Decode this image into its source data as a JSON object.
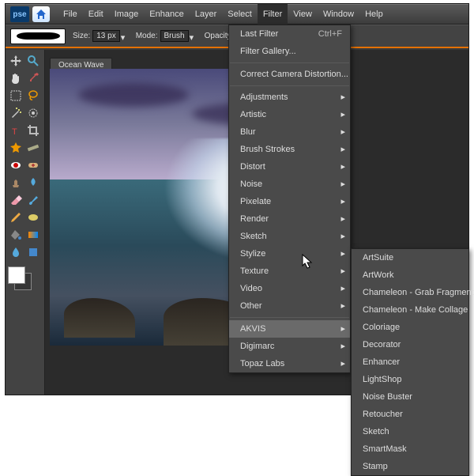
{
  "app": {
    "logo": "pse"
  },
  "menubar": [
    "File",
    "Edit",
    "Image",
    "Enhance",
    "Layer",
    "Select",
    "Filter",
    "View",
    "Window",
    "Help"
  ],
  "options": {
    "size_label": "Size:",
    "size_value": "13 px",
    "mode_label": "Mode:",
    "mode_value": "Brush",
    "opacity_label": "Opacity:"
  },
  "document": {
    "tab": "Ocean Wave"
  },
  "filter_menu": {
    "last_filter": "Last Filter",
    "last_filter_shortcut": "Ctrl+F",
    "filter_gallery": "Filter Gallery...",
    "correct_distortion": "Correct Camera Distortion...",
    "groups": [
      "Adjustments",
      "Artistic",
      "Blur",
      "Brush Strokes",
      "Distort",
      "Noise",
      "Pixelate",
      "Render",
      "Sketch",
      "Stylize",
      "Texture",
      "Video",
      "Other"
    ],
    "plugins": [
      "AKVIS",
      "Digimarc",
      "Topaz Labs"
    ]
  },
  "akvis_submenu": [
    "ArtSuite",
    "ArtWork",
    "Chameleon - Grab Fragment",
    "Chameleon - Make Collage",
    "Coloriage",
    "Decorator",
    "Enhancer",
    "LightShop",
    "Noise Buster",
    "Retoucher",
    "Sketch",
    "SmartMask",
    "Stamp"
  ],
  "tools": [
    "move",
    "zoom",
    "hand",
    "eyedropper",
    "marquee",
    "lasso",
    "wand",
    "selection-brush",
    "type",
    "crop",
    "cookie",
    "straighten",
    "red-eye",
    "heal",
    "clone",
    "smudge",
    "eraser",
    "brush",
    "pencil",
    "sponge",
    "bucket",
    "gradient",
    "blur",
    "shape"
  ]
}
